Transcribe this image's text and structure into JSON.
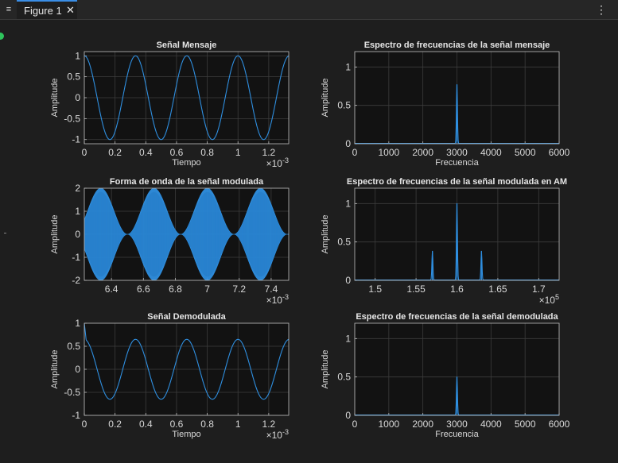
{
  "window": {
    "tab_label": "Figure 1",
    "close_glyph": "✕",
    "menu_glyph": "≡",
    "kebab_glyph": "⋮"
  },
  "colors": {
    "line": "#2f8fe0",
    "axes_bg": "#121212",
    "figure_bg": "#1e1e1e",
    "grid": "#3c3c3c",
    "text": "#d9d9d9"
  },
  "chart_data": [
    {
      "type": "line",
      "title": "Señal Mensaje",
      "xlabel": "Tiempo",
      "ylabel": "Amplitude",
      "x_multiplier": "×10-3",
      "xlim": [
        0,
        0.00133
      ],
      "ylim": [
        -1.1,
        1.1
      ],
      "xticks": [
        0,
        0.2,
        0.4,
        0.6,
        0.8,
        1,
        1.2
      ],
      "yticks": [
        -1,
        -0.5,
        0,
        0.5,
        1
      ],
      "series": [
        {
          "kind": "cosine",
          "frequency_hz": 3000,
          "amplitude": 1
        }
      ]
    },
    {
      "type": "line",
      "title": "Espectro de frecuencias de la señal mensaje",
      "xlabel": "Frecuencia",
      "ylabel": "Amplitude",
      "xlim": [
        0,
        6000
      ],
      "ylim": [
        0,
        1.2
      ],
      "xticks": [
        0,
        1000,
        2000,
        3000,
        4000,
        5000,
        6000
      ],
      "yticks": [
        0,
        0.5,
        1
      ],
      "series": [
        {
          "kind": "spectrum",
          "peaks": [
            {
              "x": 3000,
              "y": 0.77
            }
          ]
        }
      ]
    },
    {
      "type": "area",
      "title": "Forma de onda de la señal modulada",
      "xlabel": "",
      "ylabel": "Amplitude",
      "x_multiplier": "×10-3",
      "xlim": [
        0.00623,
        0.00751
      ],
      "ylim": [
        -2,
        2
      ],
      "xticks": [
        6.4,
        6.6,
        6.8,
        7,
        7.2,
        7.4
      ],
      "yticks": [
        -2,
        -1,
        0,
        1,
        2
      ],
      "series": [
        {
          "kind": "am-envelope",
          "message_frequency_hz": 3000,
          "carrier_frequency_hz": 160000,
          "envelope_max": 2,
          "envelope_min": 0
        }
      ]
    },
    {
      "type": "line",
      "title": "Espectro de frecuencias de la señal modulada en AM",
      "xlabel": "",
      "ylabel": "Amplitude",
      "x_multiplier": "×105",
      "xlim": [
        147500,
        172500
      ],
      "ylim": [
        0,
        1.2
      ],
      "xticks": [
        1.5,
        1.55,
        1.6,
        1.65,
        1.7
      ],
      "yticks": [
        0,
        0.5,
        1
      ],
      "series": [
        {
          "kind": "spectrum",
          "peaks": [
            {
              "x": 157000,
              "y": 0.38
            },
            {
              "x": 160000,
              "y": 1.0
            },
            {
              "x": 163000,
              "y": 0.38
            }
          ]
        }
      ]
    },
    {
      "type": "line",
      "title": "Señal Demodulada",
      "xlabel": "Tiempo",
      "ylabel": "Amplitude",
      "x_multiplier": "×10-3",
      "xlim": [
        0,
        0.00133
      ],
      "ylim": [
        -1,
        1
      ],
      "xticks": [
        0,
        0.2,
        0.4,
        0.6,
        0.8,
        1,
        1.2
      ],
      "yticks": [
        -1,
        -0.5,
        0,
        0.5,
        1
      ],
      "series": [
        {
          "kind": "cosine",
          "frequency_hz": 3000,
          "amplitude": 0.65,
          "startup_spike": 1.0
        }
      ]
    },
    {
      "type": "line",
      "title": "Espectro de frecuencias de la señal demodulada",
      "xlabel": "Frecuencia",
      "ylabel": "Amplitude",
      "xlim": [
        0,
        6000
      ],
      "ylim": [
        0,
        1.2
      ],
      "xticks": [
        0,
        1000,
        2000,
        3000,
        4000,
        5000,
        6000
      ],
      "yticks": [
        0,
        0.5,
        1
      ],
      "series": [
        {
          "kind": "spectrum",
          "peaks": [
            {
              "x": 3000,
              "y": 0.5
            }
          ]
        }
      ]
    }
  ]
}
